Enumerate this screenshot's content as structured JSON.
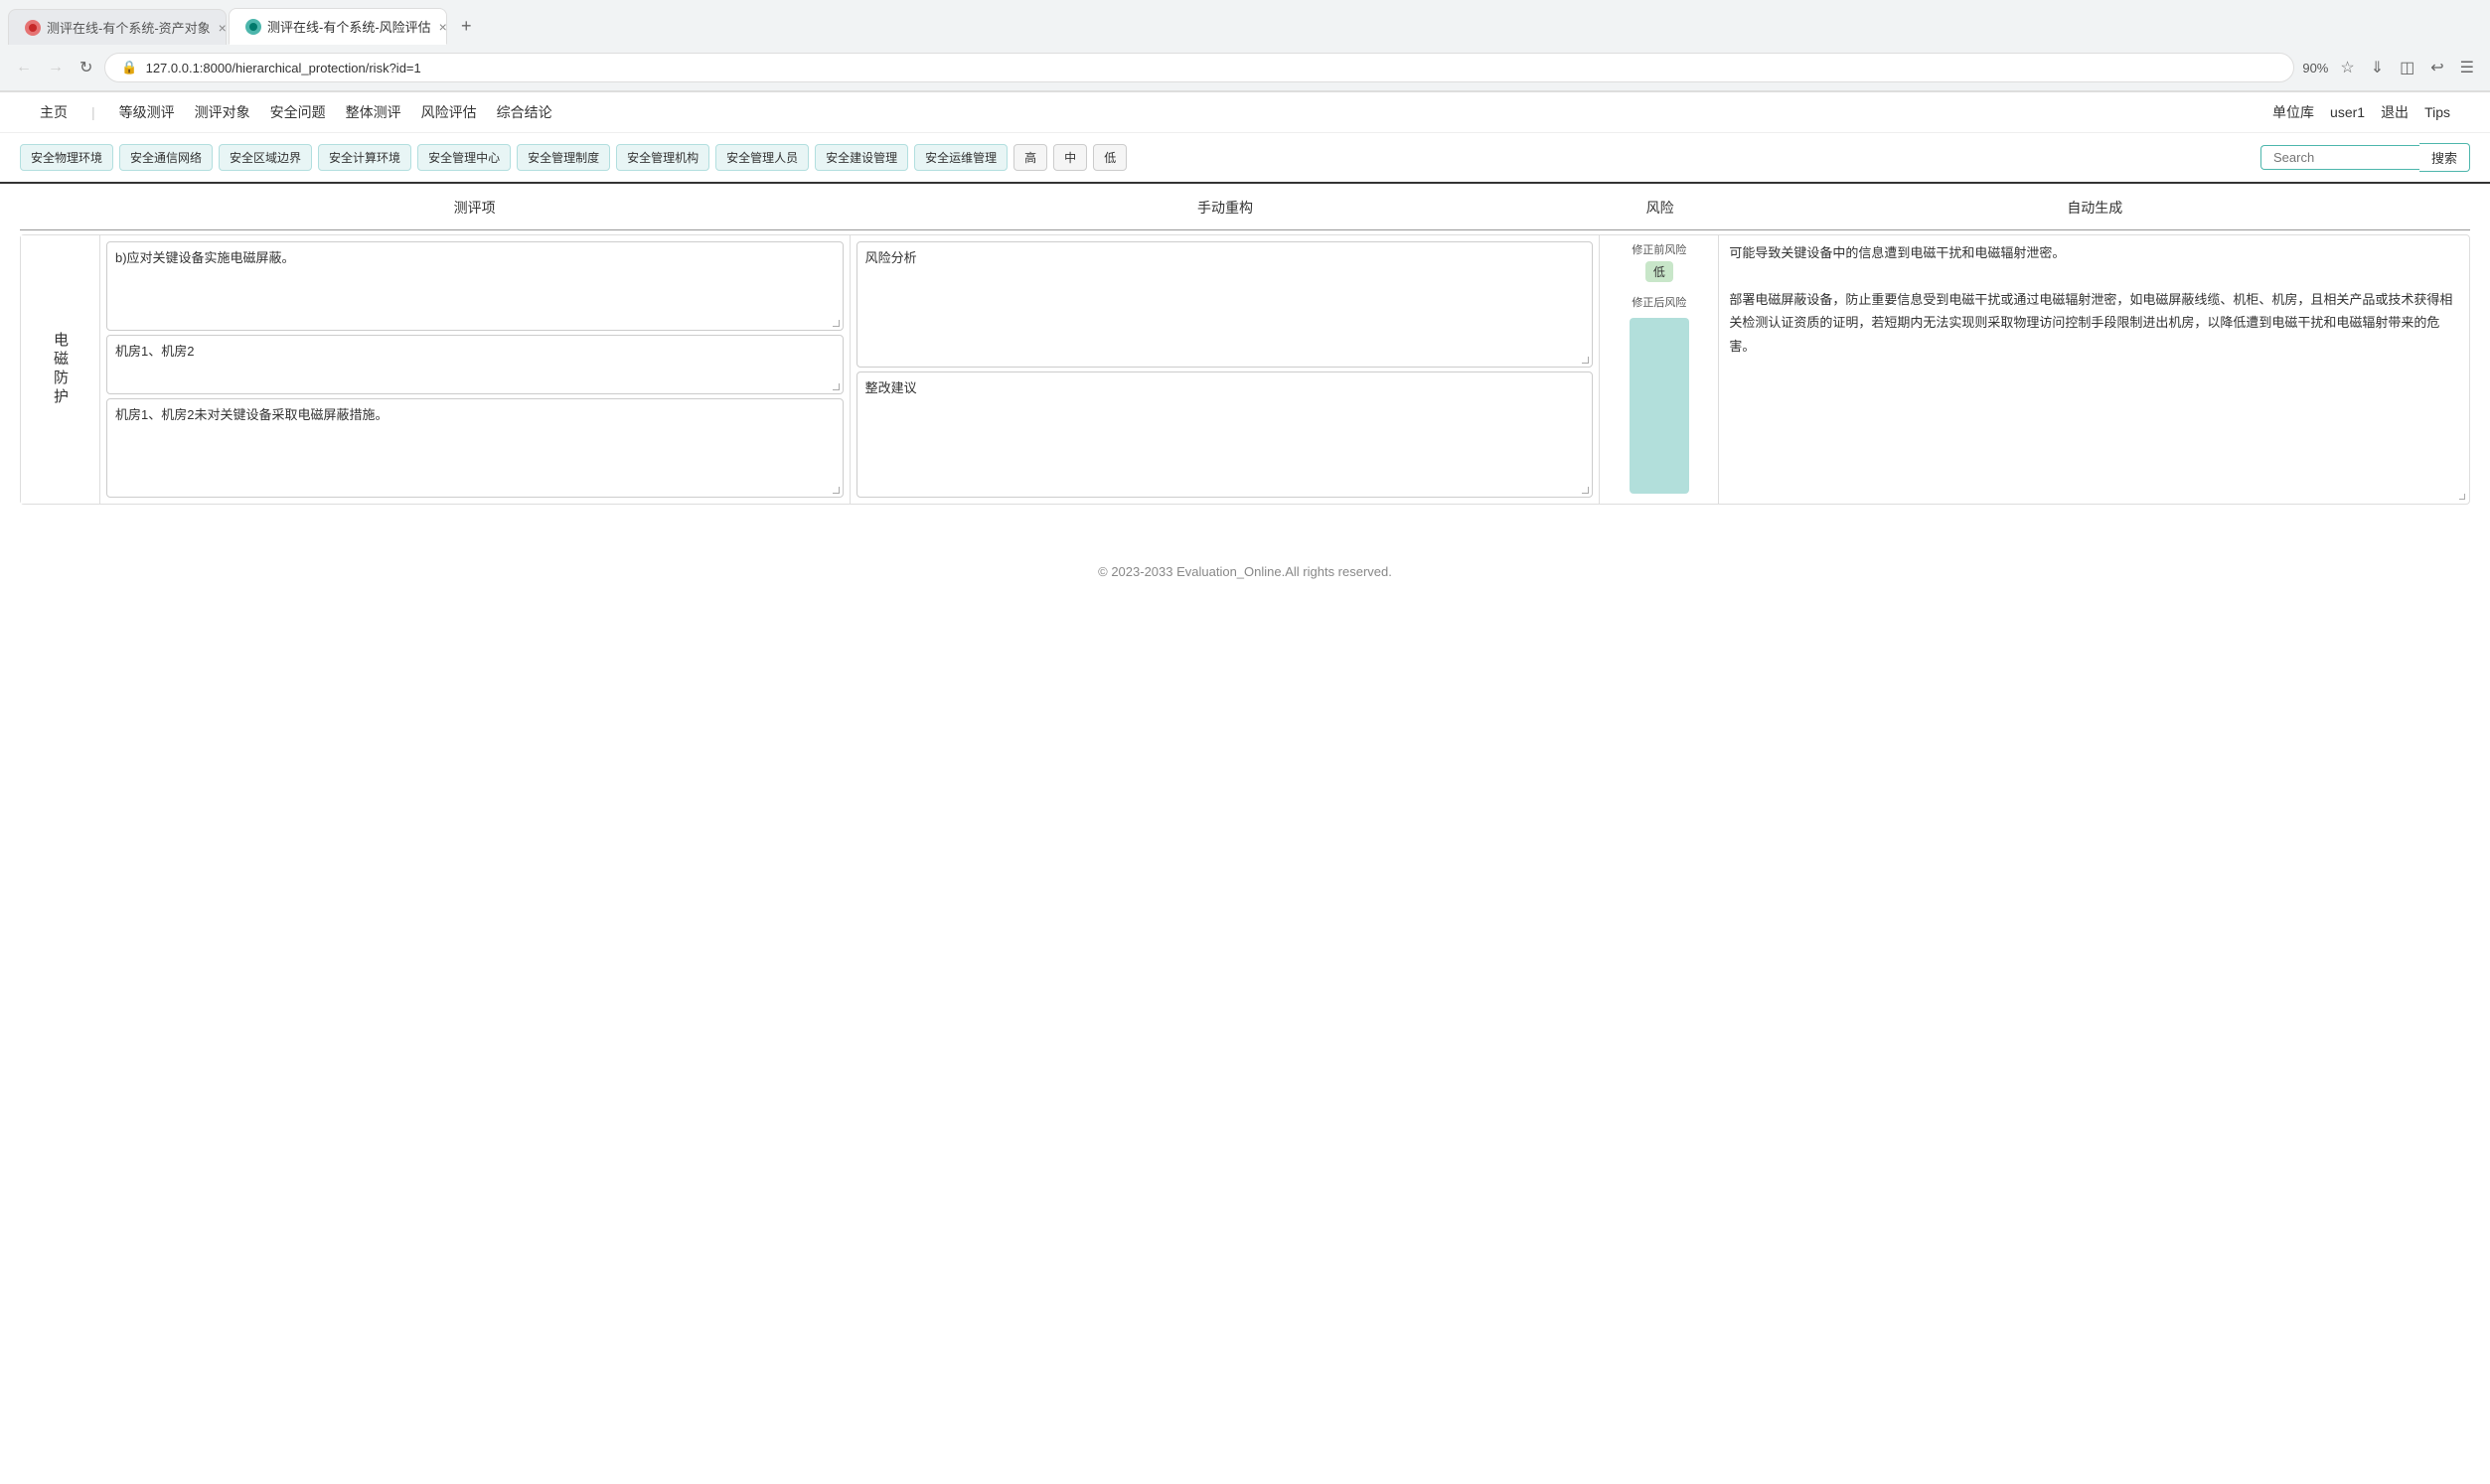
{
  "browser": {
    "tabs": [
      {
        "id": "tab1",
        "label": "测评在线-有个系统-资产对象",
        "icon_color": "#e57373",
        "active": false
      },
      {
        "id": "tab2",
        "label": "测评在线-有个系统-风险评估",
        "icon_color": "#4db6ac",
        "active": true
      }
    ],
    "add_tab_label": "+",
    "url": "127.0.0.1:8000/hierarchical_protection/risk?id=1",
    "zoom": "90%",
    "nav": {
      "back_disabled": true,
      "forward_disabled": true
    }
  },
  "app_nav": {
    "left_items": [
      {
        "id": "home",
        "label": "主页"
      },
      {
        "id": "level_eval",
        "label": "等级测评"
      },
      {
        "id": "eval_target",
        "label": "测评对象"
      },
      {
        "id": "security_issue",
        "label": "安全问题"
      },
      {
        "id": "overall_eval",
        "label": "整体测评"
      },
      {
        "id": "risk_eval",
        "label": "风险评估"
      },
      {
        "id": "summary",
        "label": "综合结论"
      }
    ],
    "right_items": [
      {
        "id": "unit_lib",
        "label": "单位库"
      },
      {
        "id": "user",
        "label": "user1"
      },
      {
        "id": "logout",
        "label": "退出"
      },
      {
        "id": "tips",
        "label": "Tips"
      }
    ]
  },
  "filter_bar": {
    "tags": [
      {
        "id": "physical",
        "label": "安全物理环境"
      },
      {
        "id": "network",
        "label": "安全通信网络"
      },
      {
        "id": "zone",
        "label": "安全区域边界"
      },
      {
        "id": "compute",
        "label": "安全计算环境"
      },
      {
        "id": "mgmt_center",
        "label": "安全管理中心"
      },
      {
        "id": "mgmt_system",
        "label": "安全管理制度"
      },
      {
        "id": "mgmt_org",
        "label": "安全管理机构"
      },
      {
        "id": "mgmt_person",
        "label": "安全管理人员"
      },
      {
        "id": "build_mgmt",
        "label": "安全建设管理"
      },
      {
        "id": "ops_mgmt",
        "label": "安全运维管理"
      }
    ],
    "levels": [
      {
        "id": "high",
        "label": "高"
      },
      {
        "id": "mid",
        "label": "中"
      },
      {
        "id": "low",
        "label": "低"
      }
    ],
    "search": {
      "placeholder": "Search",
      "button_label": "搜索"
    }
  },
  "table": {
    "headers": [
      {
        "id": "eval_item",
        "label": ""
      },
      {
        "id": "eval_content",
        "label": "测评项"
      },
      {
        "id": "manual_recon",
        "label": "手动重构"
      },
      {
        "id": "risk",
        "label": "风险"
      },
      {
        "id": "auto_gen",
        "label": "自动生成"
      }
    ],
    "rows": [
      {
        "id": "row1",
        "label": "电磁防护",
        "label_chars": [
          "电",
          "磁",
          "防",
          "护"
        ],
        "eval_items": [
          {
            "id": "eval1",
            "text": "b)应对关键设备实施电磁屏蔽。"
          },
          {
            "id": "eval2",
            "text": "机房1、机房2"
          },
          {
            "id": "eval3",
            "text": "机房1、机房2未对关键设备采取电磁屏蔽措施。"
          }
        ],
        "manual_items": [
          {
            "id": "manual1",
            "text": "风险分析"
          },
          {
            "id": "manual2",
            "text": "整改建议"
          }
        ],
        "risk": {
          "before_label": "修正前风险",
          "before_level": "低",
          "after_label": "修正后风险",
          "bar_color": "#b2dfdb"
        },
        "auto_text": "可能导致关键设备中的信息遭到电磁干扰和电磁辐射泄密。\n\n部署电磁屏蔽设备，防止重要信息受到电磁干扰或通过电磁辐射泄密，如电磁屏蔽线缆、机柜、机房，且相关产品或技术获得相关检测认证资质的证明，若短期内无法实现则采取物理访问控制手段限制进出机房，以降低遭到电磁干扰和电磁辐射带来的危害。"
      }
    ]
  },
  "footer": {
    "text": "© 2023-2033 Evaluation_Online.All rights reserved."
  }
}
